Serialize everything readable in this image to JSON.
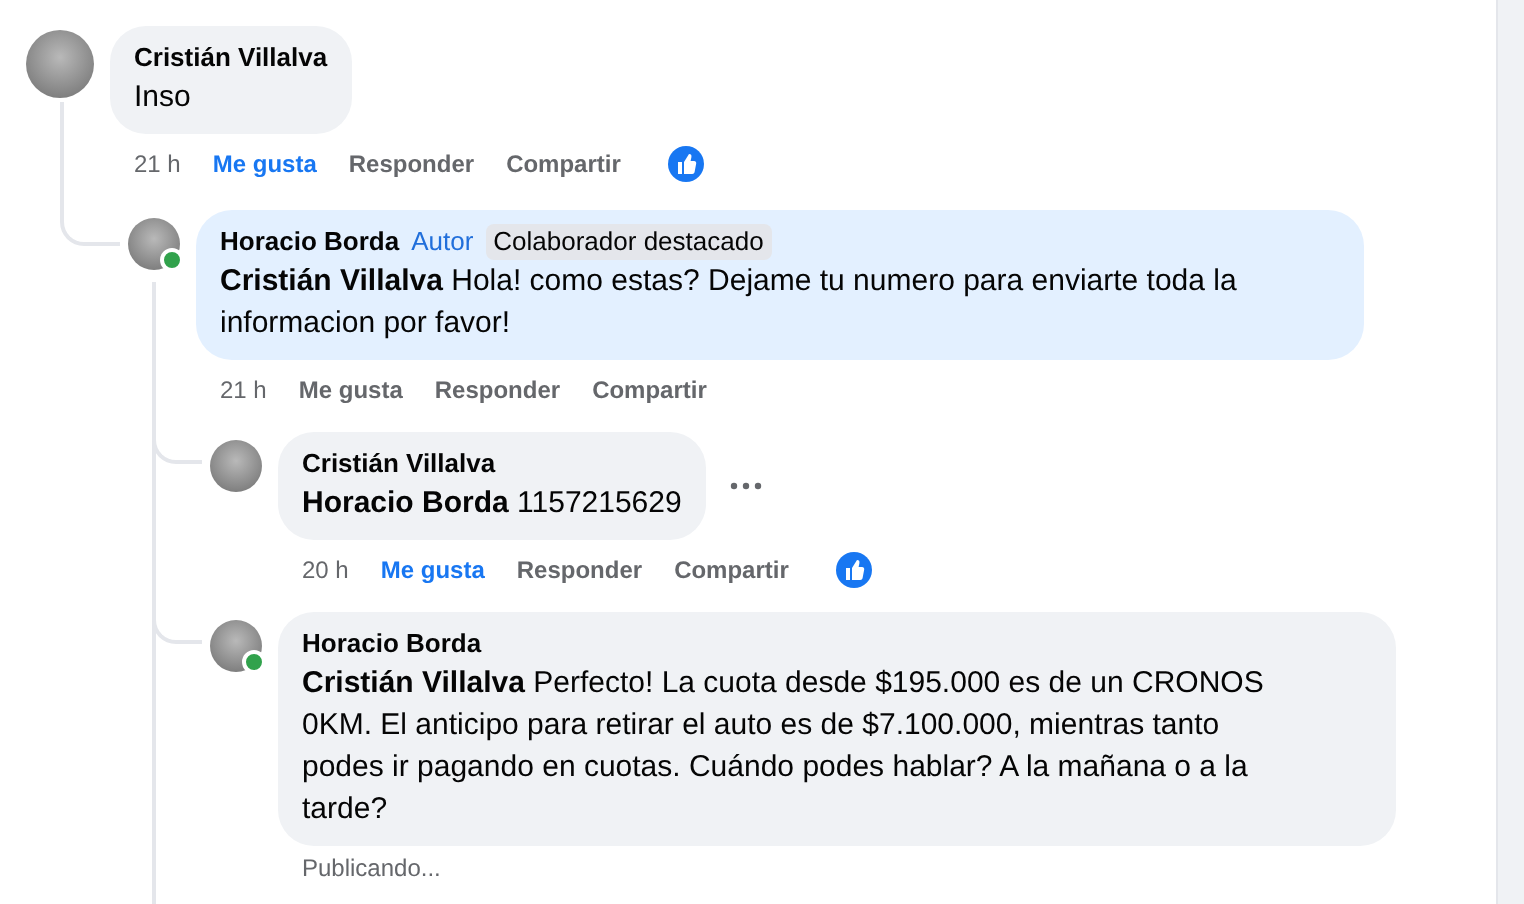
{
  "comments": [
    {
      "author": "Cristián Villalva",
      "text": "Inso",
      "time": "21 h",
      "reaction": true,
      "actions": [
        {
          "label": "Me gusta",
          "selected": true
        },
        {
          "label": "Responder",
          "selected": false
        },
        {
          "label": "Compartir",
          "selected": false
        }
      ],
      "children": [
        {
          "author": "Horacio Borda",
          "badges": [
            {
              "label": "Autor",
              "kind": "role"
            },
            {
              "label": "Colaborador destacado",
              "kind": "tag"
            }
          ],
          "mention": "Cristián Villalva",
          "text": "Hola! como estas? Dejame tu numero para enviarte toda la informacion por favor!",
          "time": "21 h",
          "online": true,
          "highlight": true,
          "actions": [
            {
              "label": "Me gusta",
              "selected": false
            },
            {
              "label": "Responder",
              "selected": false
            },
            {
              "label": "Compartir",
              "selected": false
            }
          ],
          "children": [
            {
              "author": "Cristián Villalva",
              "mention": "Horacio Borda",
              "text": "1157215629",
              "time": "20 h",
              "reaction": true,
              "more": true,
              "actions": [
                {
                  "label": "Me gusta",
                  "selected": true
                },
                {
                  "label": "Responder",
                  "selected": false
                },
                {
                  "label": "Compartir",
                  "selected": false
                }
              ]
            },
            {
              "author": "Horacio Borda",
              "mention": "Cristián Villalva",
              "text": "Perfecto! La cuota desde $195.000 es de un CRONOS 0KM. El anticipo para retirar el auto es de $7.100.000, mientras tanto podes ir pagando en cuotas. Cuándo podes hablar? A la mañana o a la tarde?",
              "status": "Publicando...",
              "online": true
            }
          ]
        }
      ]
    }
  ]
}
